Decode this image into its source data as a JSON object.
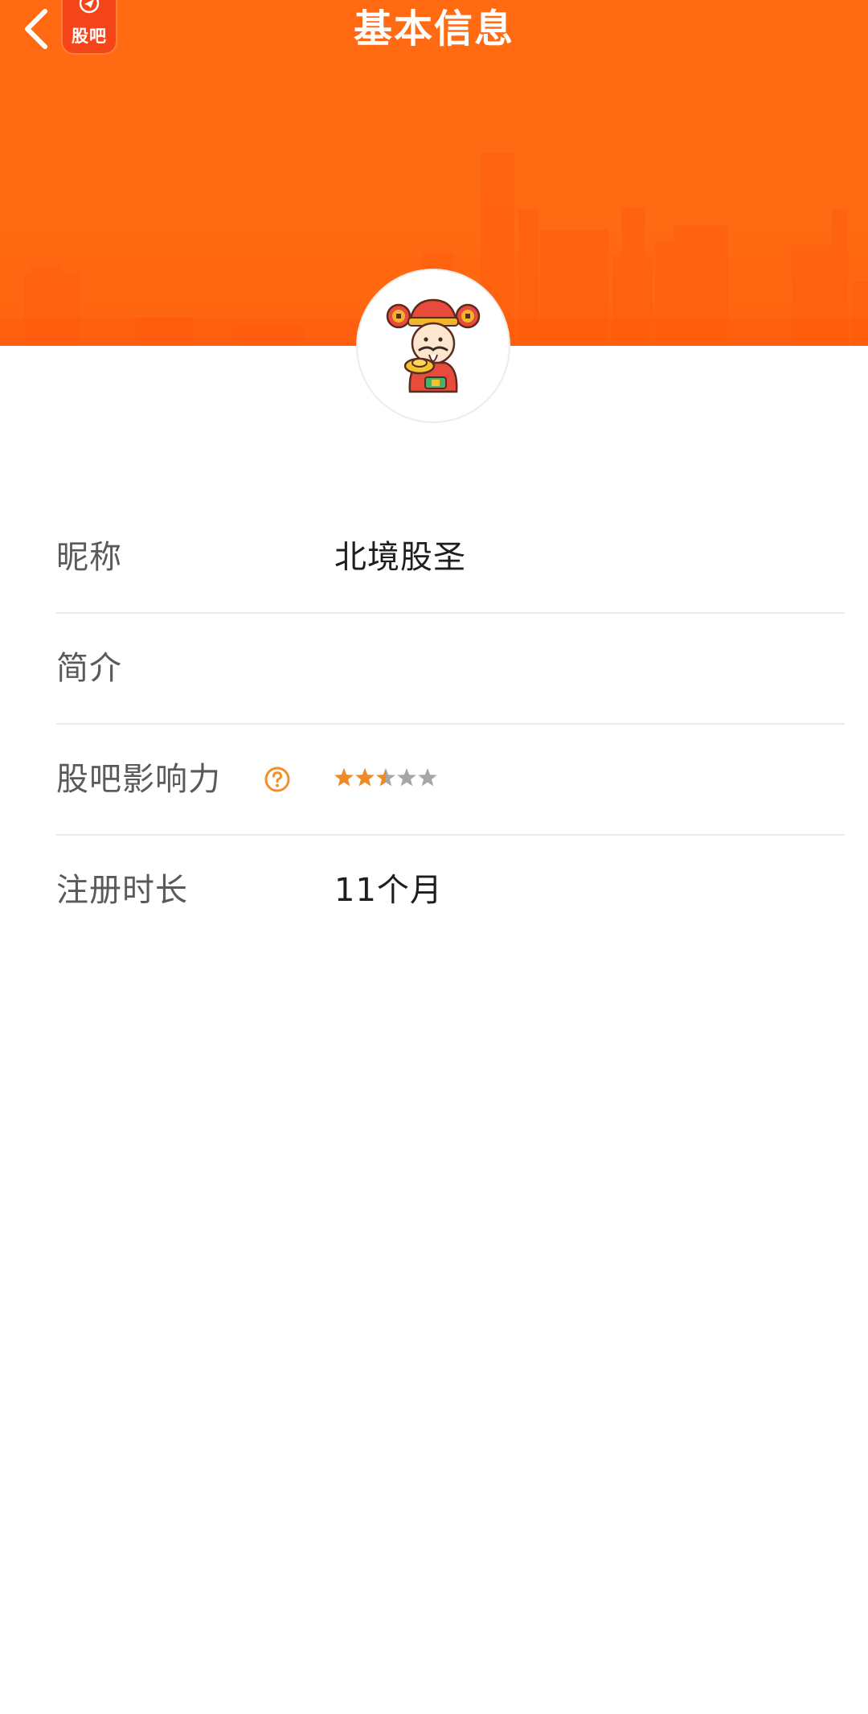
{
  "header": {
    "title": "基本信息",
    "back_icon": "chevron-left-icon",
    "app_logo_text": "股吧",
    "banner_color": "#ff6a12"
  },
  "profile": {
    "avatar_icon": "caishen-avatar-icon"
  },
  "info": {
    "nickname": {
      "label": "昵称",
      "value": "北境股圣"
    },
    "intro": {
      "label": "简介",
      "value": ""
    },
    "influence": {
      "label": "股吧影响力",
      "help_icon": "question-circle-icon",
      "rating": 2.5,
      "max_rating": 5,
      "star_active_color": "#f08a24",
      "star_inactive_color": "#a6a6a6"
    },
    "registration": {
      "label": "注册时长",
      "value": "11个月"
    }
  }
}
